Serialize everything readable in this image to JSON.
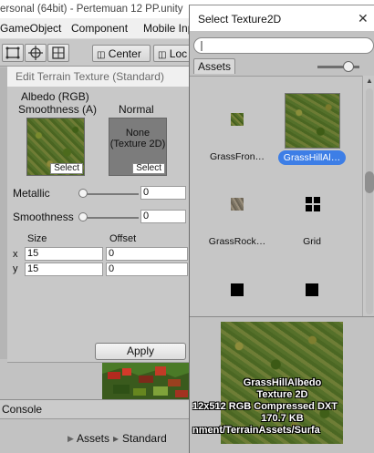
{
  "editor": {
    "window_title": "ersonal (64bit) - Pertemuan 12 PP.unity",
    "menu": [
      "GameObject",
      "Component",
      "Mobile Inp"
    ],
    "toolbar": {
      "center_label": "Center",
      "local_label": "Loc"
    },
    "console_label": "Console",
    "breadcrumb": [
      "Assets",
      "Standard"
    ]
  },
  "terrain_dialog": {
    "title": "Edit Terrain Texture (Standard)",
    "albedo_label": "Albedo (RGB)",
    "smoothness_a_label": "Smoothness (A)",
    "normal_label": "Normal",
    "normal_none_text": "None (Texture 2D)",
    "select_label": "Select",
    "metallic_label": "Metallic",
    "metallic_value": "0",
    "smoothness_label": "Smoothness",
    "smoothness_value": "0",
    "size_label": "Size",
    "offset_label": "Offset",
    "x_label": "x",
    "y_label": "y",
    "size_x": "15",
    "size_y": "15",
    "offset_x": "0",
    "offset_y": "0",
    "apply_label": "Apply"
  },
  "picker": {
    "title": "Select Texture2D",
    "search_placeholder": "",
    "tab_label": "Assets",
    "items": [
      {
        "label": "GrassFron…",
        "selected": false
      },
      {
        "label": "GrassHillAl…",
        "selected": true
      },
      {
        "label": "GrassRock…",
        "selected": false
      },
      {
        "label": "Grid",
        "selected": false
      }
    ],
    "preview": {
      "name": "GrassHillAlbedo",
      "type": "Texture 2D",
      "format": "12x512  RGB Compressed DXT",
      "size": "170.7 KB",
      "path": "nment/TerrainAssets/Surfa"
    }
  }
}
